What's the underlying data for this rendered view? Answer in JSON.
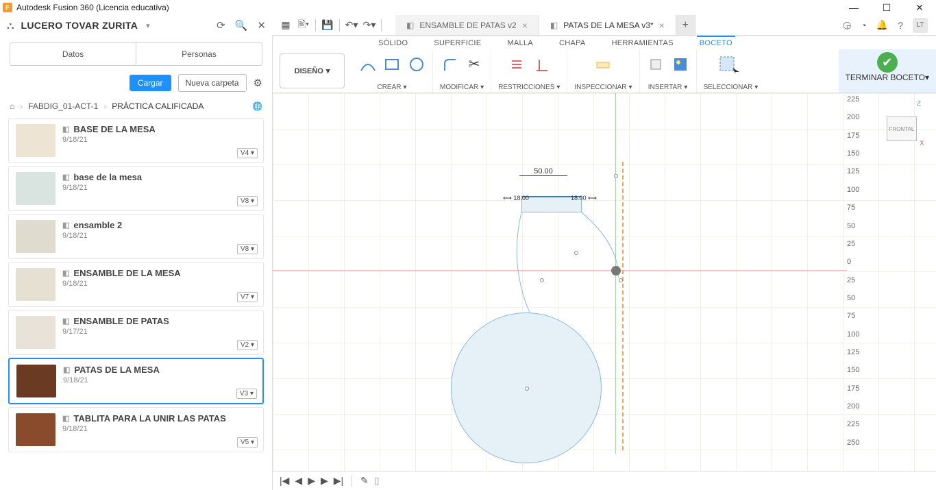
{
  "titlebar": {
    "app_title": "Autodesk Fusion 360 (Licencia educativa)",
    "app_icon_letter": "F"
  },
  "userbar": {
    "username": "LUCERO TOVAR ZURITA",
    "tabs": [
      {
        "name": "ENSAMBLE DE PATAS v2",
        "active": false
      },
      {
        "name": "PATAS DE LA MESA v3*",
        "active": true
      }
    ],
    "avatar": "LT"
  },
  "datapanel": {
    "tabs": {
      "data": "Datos",
      "people": "Personas"
    },
    "buttons": {
      "upload": "Cargar",
      "newfolder": "Nueva carpeta"
    },
    "breadcrumb": {
      "project": "FABDIG_01-ACT-1",
      "current": "PRÁCTICA CALIFICADA"
    },
    "items": [
      {
        "name": "BASE DE LA MESA",
        "date": "9/18/21",
        "version": "V4",
        "thumb": "t1"
      },
      {
        "name": "base de la mesa",
        "date": "9/18/21",
        "version": "V8",
        "thumb": "t2"
      },
      {
        "name": "ensamble 2",
        "date": "9/18/21",
        "version": "V8",
        "thumb": "t3"
      },
      {
        "name": "ENSAMBLE DE LA MESA",
        "date": "9/18/21",
        "version": "V7",
        "thumb": "t4"
      },
      {
        "name": "ENSAMBLE DE PATAS",
        "date": "9/17/21",
        "version": "V2",
        "thumb": "t5"
      },
      {
        "name": "PATAS DE LA MESA",
        "date": "9/18/21",
        "version": "V3",
        "thumb": "t6",
        "selected": true
      },
      {
        "name": "TABLITA PARA LA UNIR LAS PATAS",
        "date": "9/18/21",
        "version": "V5",
        "thumb": "t7"
      }
    ]
  },
  "ribbon": {
    "workspace_btn": "DISEÑO",
    "tabs": {
      "solid": "SÓLIDO",
      "surface": "SUPERFICIE",
      "mesh": "MALLA",
      "sheet": "CHAPA",
      "tools": "HERRAMIENTAS",
      "sketch": "BOCETO"
    },
    "groups": {
      "create": "CREAR",
      "modify": "MODIFICAR",
      "constraints": "RESTRICCIONES",
      "inspect": "INSPECCIONAR",
      "insert": "INSERTAR",
      "select": "SELECCIONAR",
      "finish": "TERMINAR BOCETO"
    }
  },
  "canvas": {
    "dim_h": "50.00",
    "dim_vl": "18.00",
    "dim_vr": "18.00",
    "viewcube": "FRONTAL",
    "axis_z": "Z",
    "axis_x": "X",
    "ruler": [
      "225",
      "200",
      "175",
      "150",
      "125",
      "100",
      "75",
      "50",
      "25",
      "0",
      "25",
      "50",
      "75",
      "100",
      "125",
      "150",
      "175",
      "200",
      "225",
      "250"
    ]
  }
}
